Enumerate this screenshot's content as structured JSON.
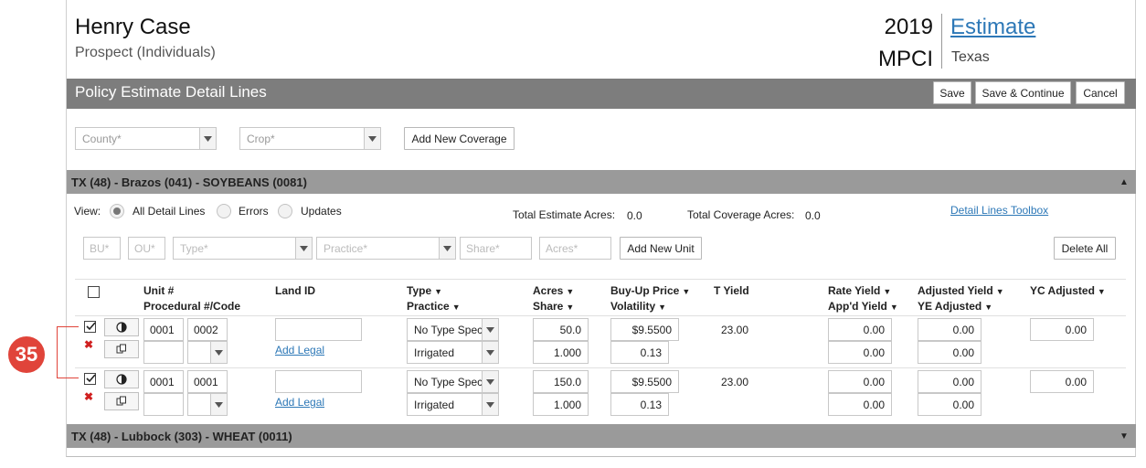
{
  "client": {
    "name": "Henry Case",
    "type": "Prospect (Individuals)"
  },
  "policy": {
    "year": "2019",
    "program": "MPCI",
    "status_link": "Estimate",
    "state": "Texas"
  },
  "section": {
    "title": "Policy Estimate Detail Lines",
    "save": "Save",
    "save_continue": "Save & Continue",
    "cancel": "Cancel"
  },
  "filters": {
    "county_placeholder": "County*",
    "crop_placeholder": "Crop*",
    "add_coverage": "Add New Coverage"
  },
  "groups": [
    {
      "title": "TX (48) - Brazos (041) - SOYBEANS (0081)",
      "arrow": "▲"
    },
    {
      "title": "TX (48) - Lubbock (303) - WHEAT (0011)",
      "arrow": "▼"
    }
  ],
  "view": {
    "label": "View:",
    "options": [
      "All Detail Lines",
      "Errors",
      "Updates"
    ],
    "selected": "All Detail Lines",
    "total_estimate_label": "Total Estimate Acres:",
    "total_estimate_value": "0.0",
    "total_coverage_label": "Total Coverage Acres:",
    "total_coverage_value": "0.0",
    "toolbox_link": "Detail Lines Toolbox"
  },
  "unit_form": {
    "bu": "BU*",
    "ou": "OU*",
    "type": "Type*",
    "practice": "Practice*",
    "share": "Share*",
    "acres": "Acres*",
    "add_unit": "Add New Unit",
    "delete_all": "Delete All"
  },
  "columns": {
    "unit": "Unit #",
    "procedural": "Procedural #/Code",
    "land_id": "Land ID",
    "type": "Type",
    "practice": "Practice",
    "acres": "Acres",
    "share": "Share",
    "buyup": "Buy-Up Price",
    "volatility": "Volatility",
    "t_yield": "T Yield",
    "rate_yield": "Rate Yield",
    "appd_yield": "App'd Yield",
    "adjusted_yield": "Adjusted Yield",
    "ye_adjusted": "YE Adjusted",
    "yc_adjusted": "YC Adjusted"
  },
  "rows": [
    {
      "checked": true,
      "unit": "0001",
      "unit2": "0002",
      "land_link": "Add Legal",
      "type": "No Type Spec",
      "practice": "Irrigated",
      "acres": "50.0",
      "share": "1.000",
      "buyup": "$9.5500",
      "volatility": "0.13",
      "t_yield": "23.00",
      "rate_yield": "0.00",
      "appd_yield": "0.00",
      "adjusted_yield": "0.00",
      "ye_adjusted": "0.00",
      "yc_adjusted": "0.00"
    },
    {
      "checked": true,
      "unit": "0001",
      "unit2": "0001",
      "land_link": "Add Legal",
      "type": "No Type Spec",
      "practice": "Irrigated",
      "acres": "150.0",
      "share": "1.000",
      "buyup": "$9.5500",
      "volatility": "0.13",
      "t_yield": "23.00",
      "rate_yield": "0.00",
      "appd_yield": "0.00",
      "adjusted_yield": "0.00",
      "ye_adjusted": "0.00",
      "yc_adjusted": "0.00"
    }
  ],
  "annotation": {
    "badge": "35",
    "color": "#e0443a"
  },
  "colors": {
    "section_bar": "#7d7d7d",
    "group_bar": "#9a9a9a",
    "link": "#2d78b7"
  }
}
